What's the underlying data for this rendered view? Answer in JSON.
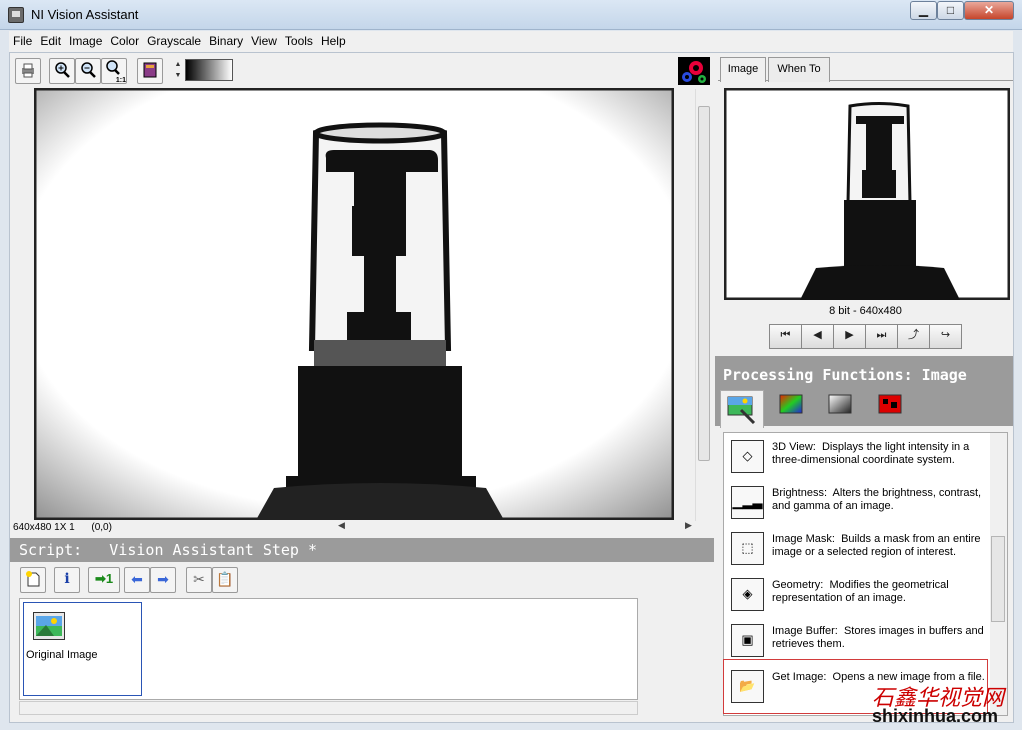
{
  "window": {
    "title": "NI Vision Assistant",
    "minimize": "▁",
    "maximize": "□",
    "close": "✕"
  },
  "menu": [
    "File",
    "Edit",
    "Image",
    "Color",
    "Grayscale",
    "Binary",
    "View",
    "Tools",
    "Help"
  ],
  "toolbar": {
    "print_icon": "printer-icon",
    "zoom_in_icon": "zoom-in-icon",
    "zoom_out_icon": "zoom-out-icon",
    "zoom_1to1_icon": "zoom-1to1-icon",
    "zoom_1to1_label": "1:1",
    "book_icon": "book-icon"
  },
  "display": {
    "status": "640x480 1X 1      (0,0)"
  },
  "script": {
    "header": "Script:   Vision Assistant Step *",
    "step_label": "Original Image"
  },
  "right": {
    "tabs": [
      "Image",
      "When To"
    ],
    "preview_caption": "8 bit - 640x480",
    "nav_buttons": [
      "⏮",
      "◀",
      "▶",
      "⏭",
      "⤴",
      "↪"
    ],
    "processing_header": "Processing Functions: Image"
  },
  "functions": [
    {
      "name": "3D View:",
      "desc": "Displays the light intensity in a three-dimensional coordinate system.",
      "icon": "3d-view-icon",
      "glyph": "◇"
    },
    {
      "name": "Brightness:",
      "desc": "Alters the brightness, contrast, and gamma of an image.",
      "icon": "brightness-icon",
      "glyph": "▁▂▃"
    },
    {
      "name": "Image Mask:",
      "desc": "Builds a mask from an entire image or a selected region of interest.",
      "icon": "image-mask-icon",
      "glyph": "⬚"
    },
    {
      "name": "Geometry:",
      "desc": "Modifies the geometrical representation of an image.",
      "icon": "geometry-icon",
      "glyph": "◈"
    },
    {
      "name": "Image Buffer:",
      "desc": "Stores images in buffers and retrieves them.",
      "icon": "image-buffer-icon",
      "glyph": "▣"
    },
    {
      "name": "Get Image:",
      "desc": "Opens a new image from a file.",
      "icon": "get-image-icon",
      "glyph": "📂"
    }
  ],
  "watermark": {
    "cn": "石鑫华视觉网",
    "url": "shixinhua.com"
  }
}
